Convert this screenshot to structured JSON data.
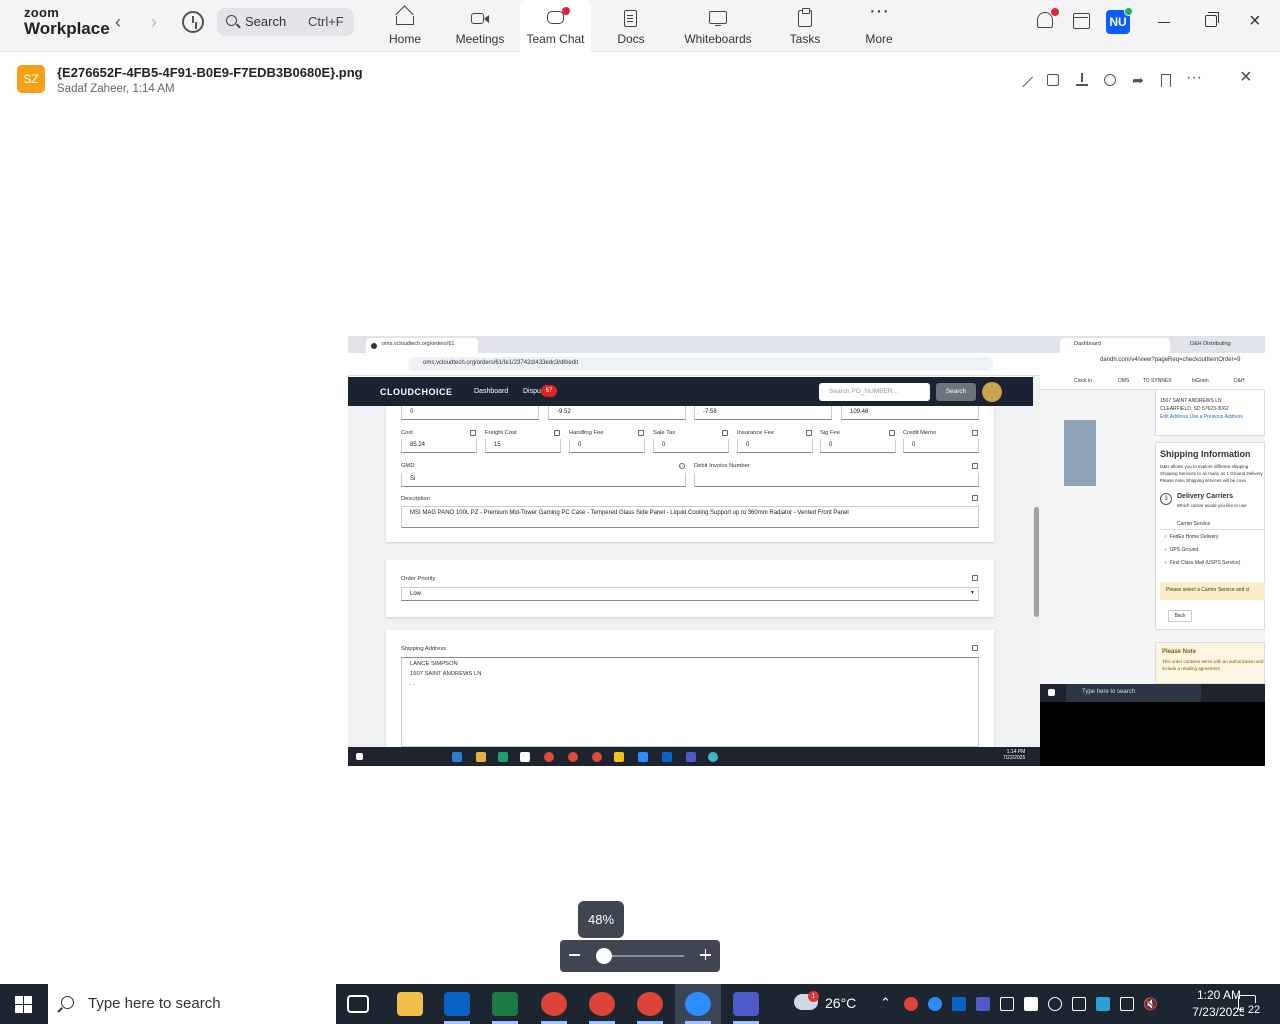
{
  "zoom": {
    "brand_line1": "zoom",
    "brand_line2": "Workplace",
    "search_label": "Search",
    "search_shortcut": "Ctrl+F",
    "nav": [
      {
        "label": "Home",
        "icon": "home-icon"
      },
      {
        "label": "Meetings",
        "icon": "video-camera-icon"
      },
      {
        "label": "Team Chat",
        "icon": "chat-bubble-icon",
        "active": true
      },
      {
        "label": "Docs",
        "icon": "document-icon"
      },
      {
        "label": "Whiteboards",
        "icon": "whiteboard-icon"
      },
      {
        "label": "Tasks",
        "icon": "task-list-icon"
      },
      {
        "label": "More",
        "icon": "more-dots-icon"
      }
    ],
    "avatar_initials": "NU",
    "accent_color": "#0b5cff",
    "notification_color": "#e0243a"
  },
  "file": {
    "avatar_initials": "SZ",
    "avatar_color": "#f5a017",
    "name": "{E276652F-4FB5-4F91-B0E9-F7EDB3B0680E}.png",
    "sender_time": "Sadaf Zaheer, 1:14 AM"
  },
  "screenshot": {
    "tab_title": "oms.vcloudtech.org/orders/61",
    "url": "oms.vcloudtech.org/orders/61/fe1/23742d/433edc3/d8/edit",
    "app_logo": "CLOUDCHOICE",
    "nav_dashboard": "Dashboard",
    "nav_dispute": "Dispu",
    "dispute_badge": "67",
    "po_search_placeholder": "Search PO_NUMBER...",
    "search_button": "Search",
    "top_row_values": [
      "0",
      "-9.52",
      "-7.58",
      "109.48"
    ],
    "cost_fields": [
      {
        "label": "Cost",
        "value": "85.24"
      },
      {
        "label": "Freight Cost",
        "value": "15"
      },
      {
        "label": "Handling Fee",
        "value": "0"
      },
      {
        "label": "Sale Tax",
        "value": "0"
      },
      {
        "label": "Insurance Fee",
        "value": "0"
      },
      {
        "label": "Sig Fee",
        "value": "0"
      },
      {
        "label": "Credit Memo",
        "value": "0"
      }
    ],
    "gmd_label": "GMD",
    "gmd_value": "Si",
    "debit_label": "Debit Invoice Number",
    "description_label": "Description",
    "description_value": "MSI MAG PANO 100L PZ - Premium Mid-Tower Gaming PC Case - Tempered Glass Side Panel - Liquid Cooling Support up to 360mm Radiator - Vented Front Panel",
    "order_priority_label": "Order Priority",
    "order_priority_value": "Low",
    "shipping_label": "Shipping Address",
    "shipping_line1": "LANCE SIMPSON",
    "shipping_line2": "1507 SAINT ANDREWS LN",
    "shipping_line3": ", ,",
    "inner_clock_time": "1:14 PM",
    "inner_clock_date": "7/22/2025"
  },
  "right_window": {
    "tab1": "Dashboard",
    "tab2": "D&H Distributing",
    "url": "dandh.com/v4/view?pageReq=checkoutItemOrder=9",
    "bookmarks": [
      "Clock In",
      "OMS",
      "TD SYNNEX",
      "InGram",
      "D&H"
    ],
    "address_lines": [
      "1507 SAINT ANDREWS LN",
      "CLEARFIELD, SD 57623-3062",
      "Edit Address Use a Previous Address"
    ],
    "shipping_title": "Shipping Information",
    "shipping_desc": "D&H allows you to explore different shipping Shipping Services to as many as 1 Ground Delivery Please note, Shipping services will be cove",
    "step_number": "3",
    "delivery_title": "Delivery Carriers",
    "delivery_sub": "Which carrier would you like to use",
    "carrier_header": "Carrier Service",
    "carriers": [
      "FedEx Home Delivery",
      "UPS Ground",
      "First Class Mail (USPS Service)"
    ],
    "warning": "Please select a Carrier Service and cl",
    "back_button": "Back",
    "note_title": "Please Note",
    "note_text": "This order contains items with an authorization and include a retailing agreement",
    "taskbar_search": "Type here to search"
  },
  "viewer": {
    "zoom_level": "48%",
    "zoom_fraction": 0.48
  },
  "taskbar": {
    "search_placeholder": "Type here to search",
    "temperature": "26°C",
    "weather_badge": "1",
    "time": "1:20 AM",
    "date": "7/23/2025",
    "notification_count": "22"
  }
}
